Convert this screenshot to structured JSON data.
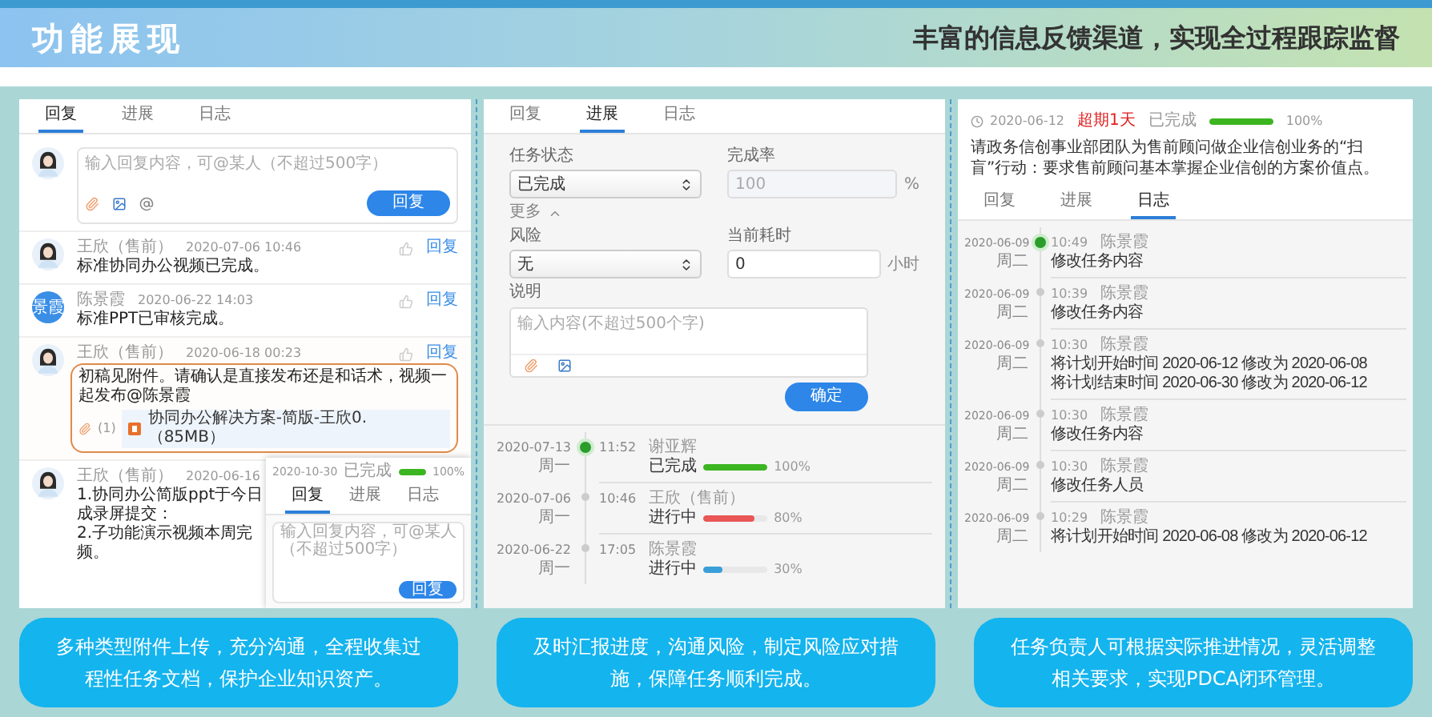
{
  "header": {
    "title": "功能展现",
    "subtitle": "丰富的信息反馈渠道，实现全过程跟踪监督"
  },
  "reply_panel": {
    "tabs": [
      {
        "label": "回复",
        "selected": true
      },
      {
        "label": "进展",
        "selected": false
      },
      {
        "label": "日志",
        "selected": false
      }
    ],
    "composer": {
      "avatar": {
        "kind": "photo"
      },
      "placeholder": "输入回复内容，可@某人（不超过500字）",
      "button": "回复"
    },
    "comments": [
      {
        "avatar": {
          "kind": "photo"
        },
        "author": "王欣（售前）",
        "time": "2020-07-06 10:46",
        "text": "标准协同办公视频已完成。",
        "reply": "回复",
        "highlighted": false
      },
      {
        "avatar": {
          "kind": "initials",
          "text": "景霞"
        },
        "author": "陈景霞",
        "time": "2020-06-22 14:03",
        "text": "标准PPT已审核完成。",
        "reply": "回复",
        "highlighted": false
      },
      {
        "avatar": {
          "kind": "photo"
        },
        "author": "王欣（售前）",
        "time": "2020-06-18 00:23",
        "text": "初稿见附件。请确认是直接发布还是和话术，视频一起发布@陈景霞",
        "reply": "回复",
        "highlighted": true,
        "attachment_count": "(1)",
        "attachment": "协同办公解决方案-简版-王欣0.（85MB）"
      },
      {
        "avatar": {
          "kind": "photo"
        },
        "author": "王欣（售前）",
        "time": "2020-06-16",
        "lines": [
          "1.协同办公简版ppt于今日",
          "成录屏提交：",
          "2.子功能演示视频本周完",
          "频。"
        ],
        "highlighted": false
      }
    ]
  },
  "overlay_screenshot": {
    "date": "2020-10-30",
    "status": "已完成",
    "level": 1,
    "percent": "100%",
    "tabs": [
      {
        "label": "回复",
        "selected": true
      },
      {
        "label": "进展",
        "selected": false
      },
      {
        "label": "日志",
        "selected": false
      }
    ],
    "placeholder": "输入回复内容，可@某人（不超过500字）",
    "button": "回复"
  },
  "progress_panel": {
    "tabs": [
      {
        "label": "回复",
        "selected": false
      },
      {
        "label": "进展",
        "selected": true
      },
      {
        "label": "日志",
        "selected": false
      }
    ],
    "status": {
      "label": "任务状态",
      "value": "已完成"
    },
    "completion": {
      "label": "完成率",
      "value": "100",
      "unit": "%",
      "disabled": true
    },
    "more": {
      "label": "更多",
      "expanded": true
    },
    "risk": {
      "label": "风险",
      "value": "无"
    },
    "time_spent": {
      "label": "当前耗时",
      "value": "0",
      "unit": "小时",
      "disabled": false
    },
    "note": {
      "label": "说明",
      "placeholder": "输入内容(不超过500个字)"
    },
    "button": "确定",
    "timeline": [
      {
        "date": "2020-07-13",
        "weekday": "周一",
        "time": "11:52",
        "author": "谢亚辉",
        "status": "已完成",
        "level": 1,
        "percent": "100%",
        "color": "#3cb521",
        "current": true
      },
      {
        "date": "2020-07-06",
        "weekday": "周一",
        "time": "10:46",
        "author": "王欣（售前）",
        "status": "进行中",
        "level": 0.8,
        "percent": "80%",
        "color": "#e85656",
        "current": false
      },
      {
        "date": "2020-06-22",
        "weekday": "周一",
        "time": "17:05",
        "author": "陈景霞",
        "status": "进行中",
        "level": 0.3,
        "percent": "30%",
        "color": "#3a9fd8",
        "current": false
      }
    ]
  },
  "log_panel": {
    "date": "2020-06-12",
    "overdue": "超期1天",
    "status": "已完成",
    "level": 1,
    "percent": "100%",
    "description": "请政务信创事业部团队为售前顾问做企业信创业务的“扫盲”行动：要求售前顾问基本掌握企业信创的方案价值点。",
    "tabs": [
      {
        "label": "回复",
        "selected": false
      },
      {
        "label": "进展",
        "selected": false
      },
      {
        "label": "日志",
        "selected": true
      }
    ],
    "entries": [
      {
        "date": "2020-06-09",
        "weekday": "周二",
        "time": "10:49",
        "author": "陈景霞",
        "lines": [
          "修改任务内容"
        ],
        "current": true
      },
      {
        "date": "2020-06-09",
        "weekday": "周二",
        "time": "10:39",
        "author": "陈景霞",
        "lines": [
          "修改任务内容"
        ],
        "current": false
      },
      {
        "date": "2020-06-09",
        "weekday": "周二",
        "time": "10:30",
        "author": "陈景霞",
        "lines": [
          "将计划开始时间 2020-06-12 修改为 2020-06-08",
          "将计划结束时间 2020-06-30 修改为 2020-06-12"
        ],
        "current": false
      },
      {
        "date": "2020-06-09",
        "weekday": "周二",
        "time": "10:30",
        "author": "陈景霞",
        "lines": [
          "修改任务内容"
        ],
        "current": false
      },
      {
        "date": "2020-06-09",
        "weekday": "周二",
        "time": "10:30",
        "author": "陈景霞",
        "lines": [
          "修改任务人员"
        ],
        "current": false
      },
      {
        "date": "2020-06-09",
        "weekday": "周二",
        "time": "10:29",
        "author": "陈景霞",
        "lines": [
          "将计划开始时间 2020-06-08 修改为 2020-06-12"
        ],
        "current": false
      }
    ]
  },
  "captions": [
    "多种类型附件上传，充分沟通，全程收集过程性任务文档，保护企业知识资产。",
    "及时汇报进度，沟通风险，制定风险应对措施，保障任务顺利完成。",
    "任务负责人可根据实际推进情况，灵活调整相关要求，实现PDCA闭环管理。"
  ]
}
